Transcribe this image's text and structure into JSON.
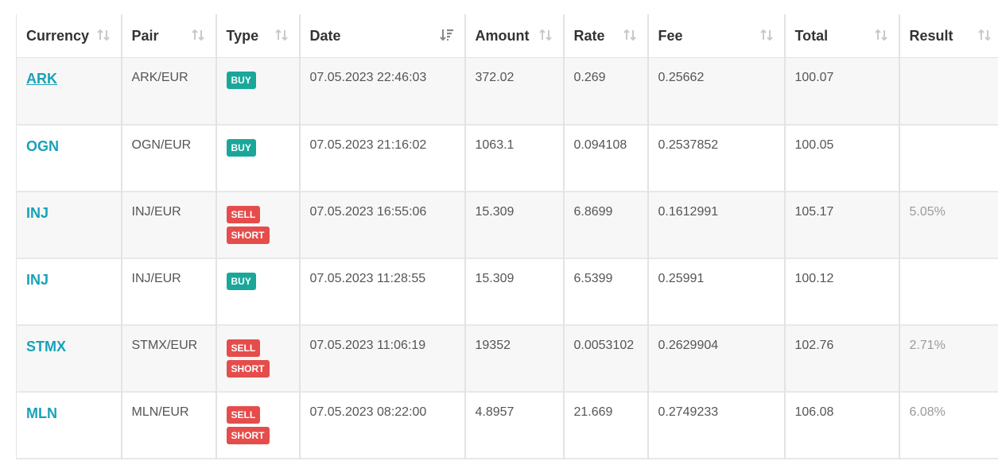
{
  "columns": [
    "Currency",
    "Pair",
    "Type",
    "Date",
    "Amount",
    "Rate",
    "Fee",
    "Total",
    "Result"
  ],
  "rows": [
    {
      "currency": "ARK",
      "pair": "ARK/EUR",
      "types": [
        "BUY"
      ],
      "date": "07.05.2023 22:46:03",
      "amount": "372.02",
      "rate": "0.269",
      "fee": "0.25662",
      "total": "100.07",
      "result": ""
    },
    {
      "currency": "OGN",
      "pair": "OGN/EUR",
      "types": [
        "BUY"
      ],
      "date": "07.05.2023 21:16:02",
      "amount": "1063.1",
      "rate": "0.094108",
      "fee": "0.2537852",
      "total": "100.05",
      "result": ""
    },
    {
      "currency": "INJ",
      "pair": "INJ/EUR",
      "types": [
        "SELL",
        "SHORT"
      ],
      "date": "07.05.2023 16:55:06",
      "amount": "15.309",
      "rate": "6.8699",
      "fee": "0.1612991",
      "total": "105.17",
      "result": "5.05%"
    },
    {
      "currency": "INJ",
      "pair": "INJ/EUR",
      "types": [
        "BUY"
      ],
      "date": "07.05.2023 11:28:55",
      "amount": "15.309",
      "rate": "6.5399",
      "fee": "0.25991",
      "total": "100.12",
      "result": ""
    },
    {
      "currency": "STMX",
      "pair": "STMX/EUR",
      "types": [
        "SELL",
        "SHORT"
      ],
      "date": "07.05.2023 11:06:19",
      "amount": "19352",
      "rate": "0.0053102",
      "fee": "0.2629904",
      "total": "102.76",
      "result": "2.71%"
    },
    {
      "currency": "MLN",
      "pair": "MLN/EUR",
      "types": [
        "SELL",
        "SHORT"
      ],
      "date": "07.05.2023 08:22:00",
      "amount": "4.8957",
      "rate": "21.669",
      "fee": "0.2749233",
      "total": "106.08",
      "result": "6.08%"
    }
  ],
  "colors": {
    "link": "#17a2b8",
    "buy": "#1aa79a",
    "sell": "#e44d4b"
  },
  "sort_icons": {
    "default": "sort-updown-icon",
    "active": "sort-desc-icon"
  }
}
